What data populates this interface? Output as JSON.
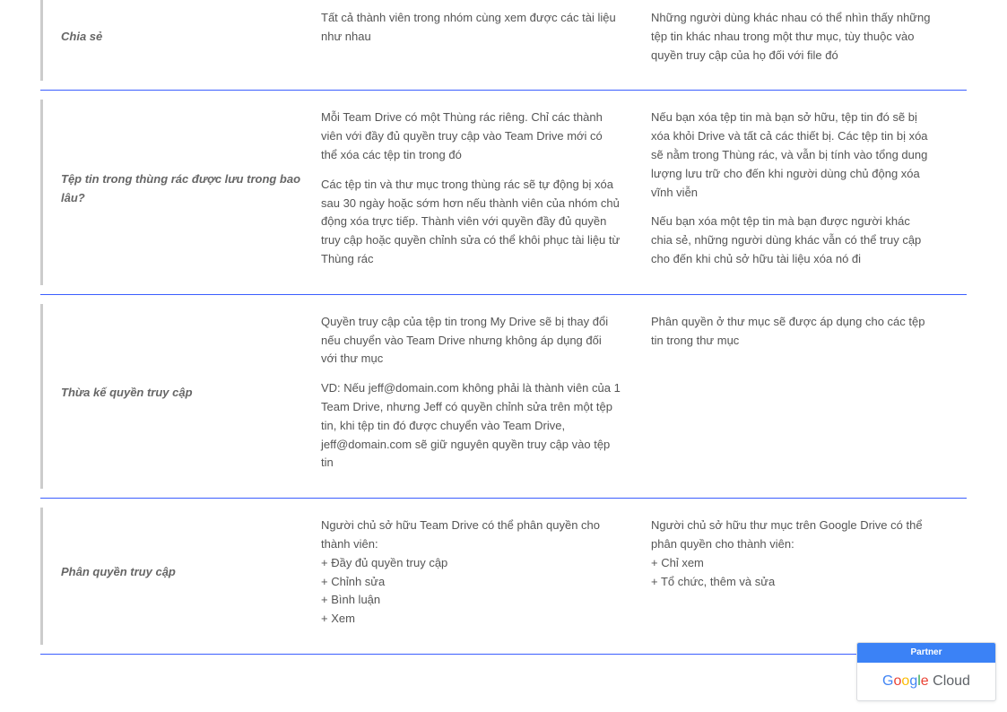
{
  "rows": [
    {
      "label": "Chia sẻ",
      "colA": "Tất cả thành viên trong nhóm cùng xem được các tài liệu như nhau",
      "colB": "Những người dùng khác nhau có thể nhìn thấy những tệp tin khác nhau trong một thư mục, tùy thuộc vào quyền truy cập của họ đối với file đó"
    },
    {
      "label": "Tệp tin trong thùng rác được lưu trong bao lâu?",
      "colA_p1": "Mỗi Team Drive có một Thùng rác riêng. Chỉ các thành viên với đầy đủ quyền truy cập vào Team Drive mới có thể xóa các tệp tin trong đó",
      "colA_p2": "Các tệp tin và thư mục trong thùng rác sẽ tự động bị xóa sau 30 ngày hoặc sớm hơn nếu thành viên của nhóm chủ động xóa trực tiếp. Thành viên với quyền đầy đủ quyền truy cập hoặc quyền chỉnh sửa có thể khôi phục tài liệu từ Thùng rác",
      "colB_p1": "Nếu bạn xóa tệp tin mà bạn sở hữu, tệp tin đó sẽ bị xóa khỏi Drive và tất cả các thiết bị. Các tệp tin bị xóa sẽ nằm trong Thùng rác, và vẫn bị tính vào tổng dung lượng lưu trữ cho đến khi người dùng chủ động xóa vĩnh viễn",
      "colB_p2": "Nếu bạn xóa một tệp tin mà bạn được người khác chia sẻ, những người dùng khác vẫn có thể truy cập cho đến khi chủ sở hữu tài liệu xóa nó đi"
    },
    {
      "label": "Thừa kế quyền truy cập",
      "colA_p1": "Quyền truy cập của tệp tin trong My Drive sẽ bị thay đổi nếu chuyển vào Team Drive nhưng không áp dụng đối với thư mục",
      "colA_p2": "VD: Nếu jeff@domain.com không phải là thành viên của 1 Team Drive, nhưng Jeff có quyền chỉnh sửa trên một tệp tin, khi tệp tin đó được chuyển vào Team Drive, jeff@domain.com sẽ giữ nguyên quyền truy cập vào tệp tin",
      "colB": "Phân quyền ở thư mục sẽ được áp dụng cho các tệp tin trong thư mục"
    },
    {
      "label": "Phân quyền truy cập",
      "colA_l1": "Người chủ sở hữu Team Drive có thể phân quyền cho thành viên:",
      "colA_l2": "+ Đầy đủ quyền truy cập",
      "colA_l3": "+ Chỉnh sửa",
      "colA_l4": "+ Bình luận",
      "colA_l5": "+ Xem",
      "colB_l1": "Người chủ sở hữu thư mục trên Google Drive có thể phân quyền cho thành viên:",
      "colB_l2": "+ Chỉ xem",
      "colB_l3": "+  Tổ chức, thêm và sửa"
    }
  ],
  "badge": {
    "top": "Partner",
    "brand_g1": "G",
    "brand_o1": "o",
    "brand_o2": "o",
    "brand_g2": "g",
    "brand_l": "l",
    "brand_e": "e",
    "brand_cloud": " Cloud"
  }
}
